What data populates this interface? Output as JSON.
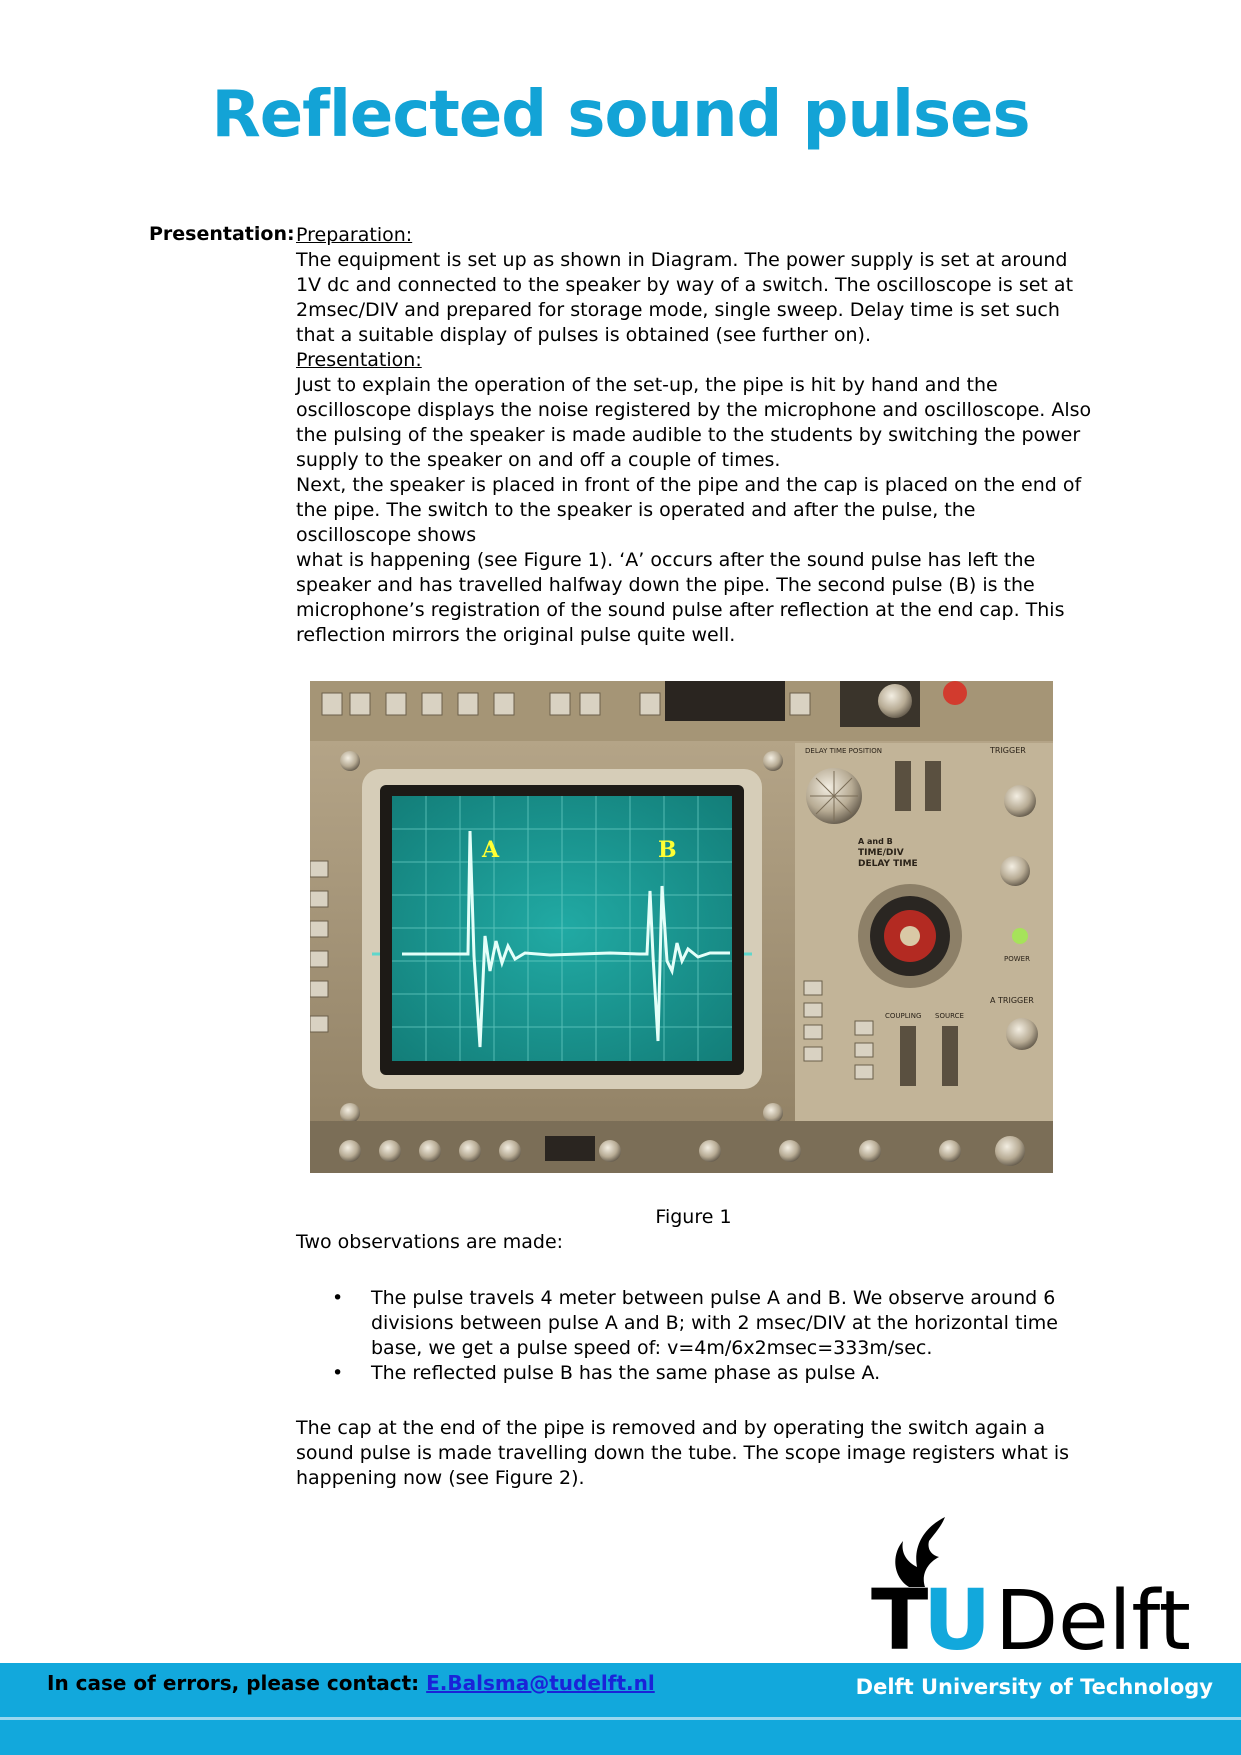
{
  "title": "Reflected sound pulses",
  "section_label": "Presentation:",
  "prep_heading": "Preparation:",
  "prep_text": "The equipment is set up as shown in Diagram. The power supply is set at around 1V dc and connected to the speaker by way of a switch. The oscilloscope is set at 2msec/DIV and prepared for storage mode, single sweep. Delay time is set such that a suitable display of pulses is obtained (see further on).",
  "pres_heading": "Presentation:",
  "pres_text_1": "Just to explain the operation of the set-up, the pipe is hit by hand and the oscilloscope displays the noise registered by the microphone and oscilloscope. Also the pulsing of the speaker is made audible to the students by switching the power supply to the speaker on and off a couple of times.",
  "pres_text_2a": "Next, the speaker is placed in front of the pipe and the cap is placed on the end of the pipe. The switch to the speaker is operated and after the pulse, the oscilloscope shows",
  "pres_text_2b": "what is happening (see Figure 1). ‘A’ occurs after the sound pulse has left the speaker and has travelled halfway down the pipe. The second pulse (B) is the microphone’s registration of the sound pulse after reflection at the end cap. This reflection mirrors the original pulse quite well.",
  "scope": {
    "pulse_a_label": "A",
    "pulse_b_label": "B",
    "delay_label": "DELAY TIME POSITION",
    "timediv_label": "TIME/DIV",
    "delay_time_label": "DELAY TIME",
    "trigger_label": "TRIGGER",
    "a_trigger_label": "A TRIGGER",
    "power_label": "POWER",
    "coupling_label": "COUPLING",
    "source_label": "SOURCE",
    "ab_label": "A and B"
  },
  "figure_caption": "Figure 1",
  "observations_intro": "Two observations are made:",
  "bullets": [
    "The pulse travels 4 meter between pulse A and B. We observe around 6 divisions between pulse A and B; with 2 msec/DIV at the horizontal time base, we get a pulse speed of: v=4m/6x2msec=333m/sec.",
    "The reflected pulse B has the same phase as pulse A."
  ],
  "closing_text": "The cap at the end of the pipe is removed and by operating the switch again a sound pulse is made travelling down the tube. The scope image registers what is happening now (see Figure 2).",
  "logo": {
    "t": "T",
    "u": "U",
    "delft": "Delft"
  },
  "footer": {
    "contact_label": "In case of errors, please contact:",
    "contact_email": "E.Balsma@tudelft.nl",
    "university": "Delft University of Technology"
  },
  "colors": {
    "title": "#13a3d6",
    "footer": "#12a8dc",
    "trace": "#d8fff8",
    "screen": "#1a9e99"
  }
}
